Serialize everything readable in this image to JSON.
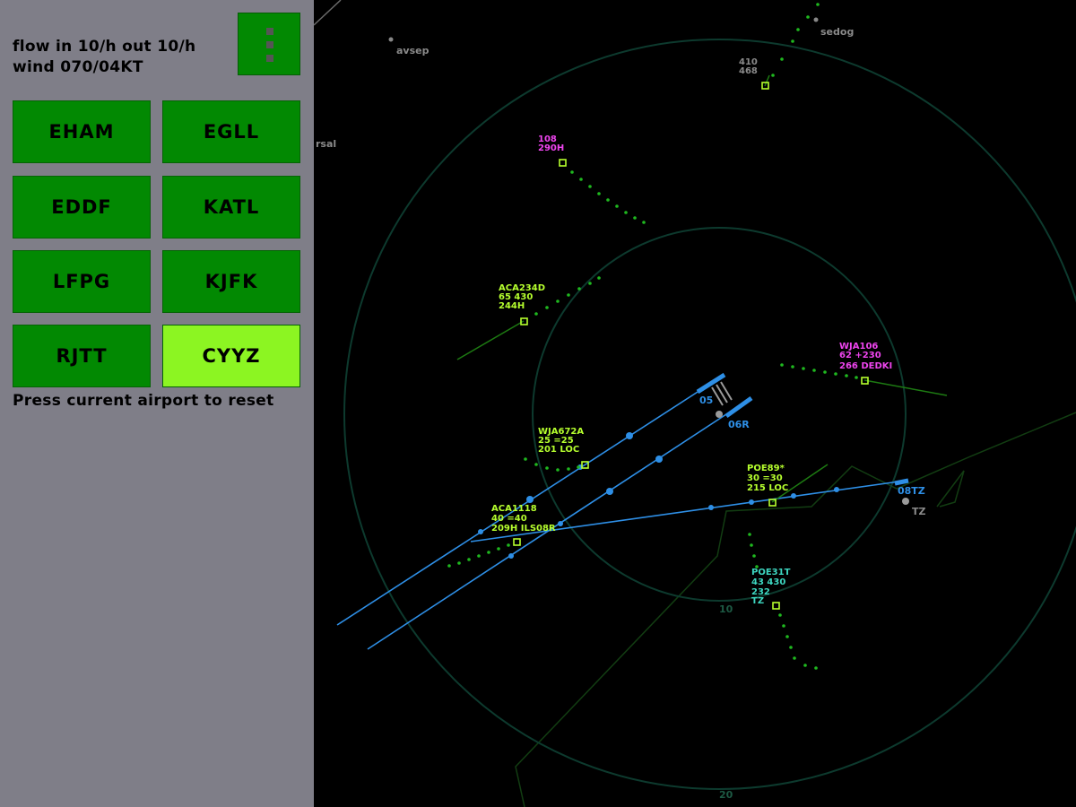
{
  "status": {
    "flow": "flow in 10/h out 10/h",
    "wind": "wind 070/04KT"
  },
  "airports": [
    {
      "code": "EHAM",
      "active": false
    },
    {
      "code": "EGLL",
      "active": false
    },
    {
      "code": "EDDF",
      "active": false
    },
    {
      "code": "KATL",
      "active": false
    },
    {
      "code": "LFPG",
      "active": false
    },
    {
      "code": "KJFK",
      "active": false
    },
    {
      "code": "RJTT",
      "active": false
    },
    {
      "code": "CYYZ",
      "active": true
    }
  ],
  "hint": "Press current airport to reset",
  "colors": {
    "panel": "#7f7e88",
    "button": "#028902",
    "button_active": "#8cf522",
    "range_ring": "#0d3a2e",
    "runway": "#2e8fe6",
    "track_green": "#b6ff2e",
    "track_magenta": "#ee44ee",
    "track_cyan": "#3dd6c0"
  },
  "radar": {
    "range_labels": [
      "10",
      "20"
    ],
    "fixes": [
      "avsep",
      "sedog",
      "rsal"
    ],
    "runways": [
      "05",
      "06R",
      "08TZ"
    ],
    "runway_marker": "TZ"
  },
  "aircraft": [
    {
      "id": "410",
      "alt": "468",
      "hdg": "",
      "color": "green"
    },
    {
      "id": "108",
      "alt": "290H",
      "hdg": "",
      "color": "magenta"
    },
    {
      "id": "ACA234D",
      "alt": "65 430",
      "hdg": "244H",
      "color": "green"
    },
    {
      "id": "WJA106",
      "alt": "62 +230",
      "hdg": "266  DEDKI",
      "color": "magenta"
    },
    {
      "id": "WJA672A",
      "alt": "25 =25",
      "hdg": "201  LOC",
      "color": "green"
    },
    {
      "id": "POE89*",
      "alt": "30 =30",
      "hdg": "215  LOC",
      "color": "green"
    },
    {
      "id": "ACA1118",
      "alt": "40 =40",
      "hdg": "209H ILS08R",
      "color": "green"
    },
    {
      "id": "POE31T",
      "alt": "43 430",
      "hdg": "232",
      "extra": "TZ",
      "color": "cyan"
    }
  ]
}
